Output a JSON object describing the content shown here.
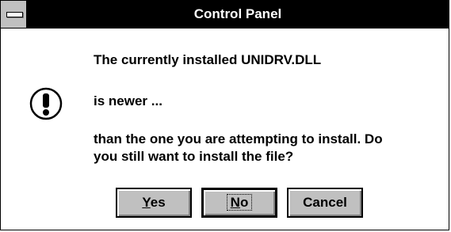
{
  "window": {
    "title": "Control Panel",
    "icon": "exclamation-icon"
  },
  "message": {
    "line1": "The currently installed UNIDRV.DLL",
    "line2": "is newer ...",
    "line3a": "than the one you are attempting to install. Do",
    "line3b": "you still want to install the file?"
  },
  "buttons": {
    "yes": {
      "mnemonic": "Y",
      "rest": "es"
    },
    "no": {
      "mnemonic": "N",
      "rest": "o"
    },
    "cancel": "Cancel"
  },
  "colors": {
    "title_bar": "#000000",
    "button_face": "#c0c0c0",
    "background": "#ffffff"
  }
}
